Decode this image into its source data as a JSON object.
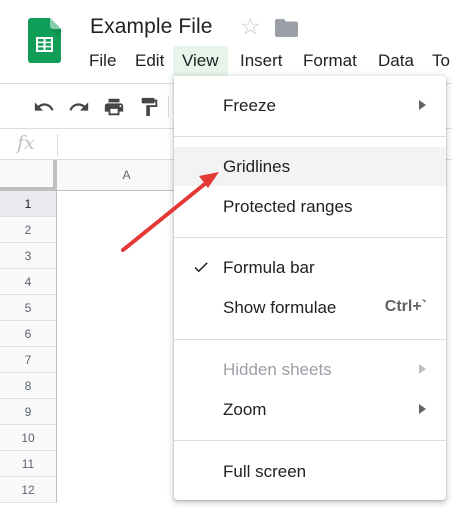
{
  "document": {
    "title": "Example File"
  },
  "icons": {
    "app": "sheets-logo-icon",
    "star": "star-icon",
    "folder": "folder-icon",
    "undo": "undo-icon",
    "redo": "redo-icon",
    "print": "print-icon",
    "paint_format": "paint-format-icon"
  },
  "menubar": {
    "items": [
      {
        "label": "File"
      },
      {
        "label": "Edit"
      },
      {
        "label": "View",
        "active": true
      },
      {
        "label": "Insert"
      },
      {
        "label": "Format"
      },
      {
        "label": "Data"
      },
      {
        "label": "To"
      }
    ]
  },
  "formula_bar": {
    "fx_label": "fx"
  },
  "grid": {
    "column_headers": [
      "A"
    ],
    "row_headers": [
      "1",
      "2",
      "3",
      "4",
      "5",
      "6",
      "7",
      "8",
      "9",
      "10",
      "11",
      "12"
    ],
    "selected_row": "1"
  },
  "view_menu": {
    "items": [
      {
        "label": "Freeze",
        "submenu": true
      },
      {
        "label": "Gridlines",
        "highlighted": true
      },
      {
        "label": "Protected ranges"
      },
      {
        "label": "Formula bar",
        "checked": true
      },
      {
        "label": "Show formulae",
        "shortcut": "Ctrl+`"
      },
      {
        "label": "Hidden sheets",
        "submenu": true,
        "disabled": true
      },
      {
        "label": "Zoom",
        "submenu": true
      },
      {
        "label": "Full screen"
      }
    ]
  },
  "colors": {
    "sheets_green": "#0f9d58",
    "menu_active_bg": "#e6f4ea",
    "annotation_arrow": "#e53935"
  }
}
